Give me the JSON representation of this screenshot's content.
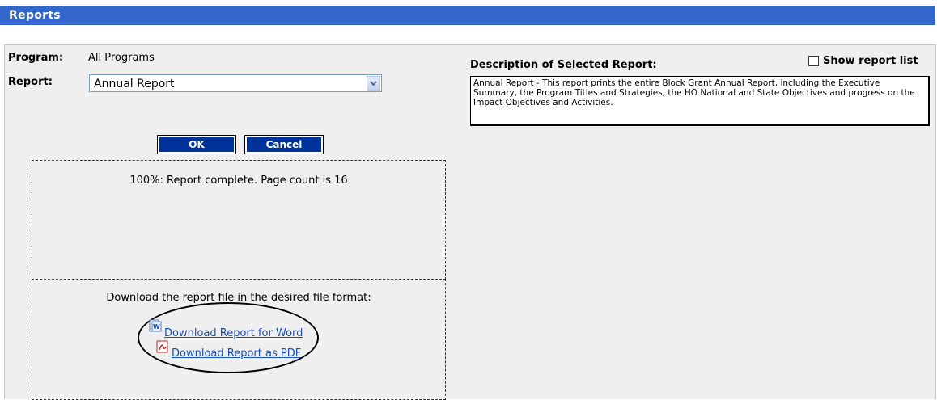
{
  "window": {
    "title": "Reports"
  },
  "form": {
    "program_label": "Program:",
    "program_value": "All Programs",
    "report_label": "Report:",
    "report_selected": "Annual Report",
    "ok_label": "OK",
    "cancel_label": "Cancel"
  },
  "progress": {
    "status_text": "100%: Report complete. Page count is 16"
  },
  "download": {
    "prompt": "Download the report file in the desired file format:",
    "word_link": "Download Report for Word",
    "pdf_link": "Download Report as PDF"
  },
  "description": {
    "label": "Description of Selected Report:",
    "text": "Annual Report - This report prints the entire Block Grant Annual Report, including the Executive Summary, the Program Titles and Strategies, the HO National and State Objectives and progress on the Impact Objectives and Activities."
  },
  "options": {
    "show_report_list_label": "Show report list",
    "show_report_list_checked": false
  },
  "icons": {
    "word": "word-doc-icon",
    "pdf": "pdf-icon",
    "dropdown": "chevron-down-icon"
  },
  "colors": {
    "titlebar": "#3366cc",
    "button": "#003399",
    "panel": "#efefef",
    "link": "#1a4fb4"
  }
}
